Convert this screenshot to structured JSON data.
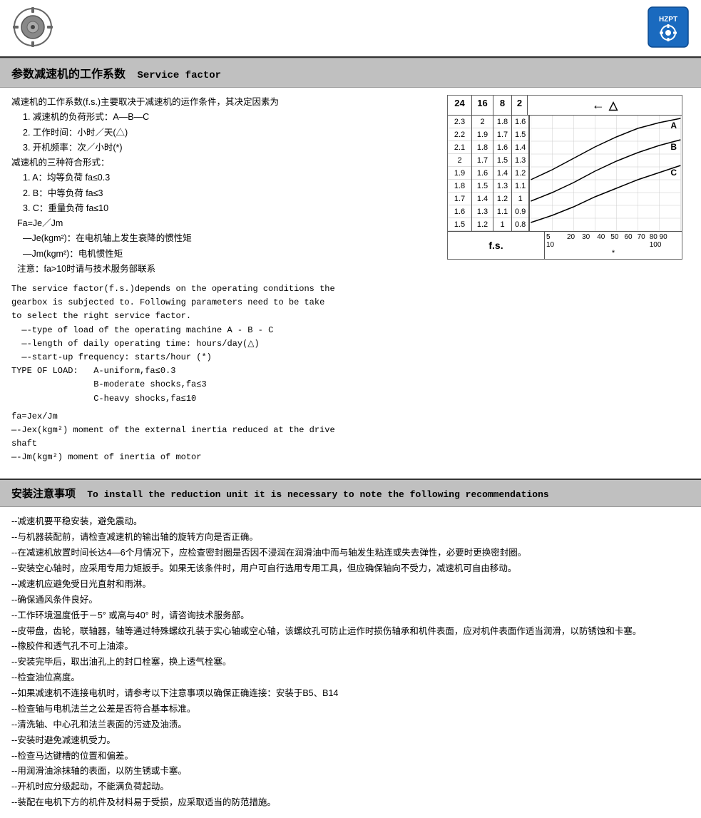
{
  "header": {
    "title_cn": "参数减速机的工作系数",
    "title_en": "Service factor"
  },
  "section1": {
    "intro_cn_lines": [
      "减速机的工作系数(f.s.)主要取决于减速机的运作条件，其决定因素为",
      "    1.  减速机的负荷形式：A—B—C",
      "    2.  工作时间：小时／天(△)",
      "    3.  开机频率：次／小时(*)",
      "减速机的三种符合形式：",
      "    1.  A：均等负荷 fa≤0.3",
      "    2.  B：中等负荷 fa≤3",
      "    3.  C：重量负荷 fa≤10",
      "  Fa=Je／Jm",
      "    —Je(kgm²)：在电机轴上发生衰降的惯性矩",
      "    —Jm(kgm²)：电机惯性矩",
      "  注意：fa>10时请与技术服务部联系"
    ],
    "intro_en_lines": [
      "The service factor(f.s.)depends on the operating conditions the",
      "gearbox is subjected to. Following parameters need to be take",
      "to select the right service factor.",
      "  —-type of load of the operating machine A - B - C",
      "  —-length of daily operating time: hours/day(△)",
      "  —-start-up frequency: starts/hour (*)",
      "TYPE OF LOAD:   A-uniform,fa≤0.3",
      "                B-moderate shocks,fa≤3",
      "                C-heavy shocks,fa≤10",
      "",
      "fa=Jex/Jm",
      "—-Jex(kgm²) moment of the external inertia reduced at the drive",
      "shaft",
      "—-Jm(kgm²) moment of inertia of motor"
    ]
  },
  "chart": {
    "col_headers": [
      "24",
      "16",
      "8",
      "2"
    ],
    "arrow_label": "△",
    "rows": [
      [
        "2.3",
        "2",
        "1.8",
        "1.6"
      ],
      [
        "2.2",
        "1.9",
        "1.7",
        "1.5"
      ],
      [
        "2.1",
        "1.8",
        "1.6",
        "1.4"
      ],
      [
        "2",
        "1.7",
        "1.5",
        "1.3"
      ],
      [
        "1.9",
        "1.6",
        "1.4",
        "1.2"
      ],
      [
        "1.8",
        "1.5",
        "1.3",
        "1.1"
      ],
      [
        "1.7",
        "1.4",
        "1.2",
        "1"
      ],
      [
        "1.6",
        "1.3",
        "1.1",
        "0.9"
      ],
      [
        "1.5",
        "1.2",
        "1",
        "0.8"
      ]
    ],
    "footer_fs": "f.s.",
    "scale_values": [
      "5 10",
      "20",
      "30",
      "40",
      "50",
      "60",
      "70",
      "80 90 100"
    ],
    "footer_star": "*",
    "curve_labels": [
      "A",
      "B",
      "C"
    ]
  },
  "section2": {
    "title_cn": "安装注意事项",
    "title_en": "To install the reduction unit it is necessary to note the following recommendations"
  },
  "install_notes": [
    "--减速机要平稳安装，避免震动。",
    "--与机器装配前，请检查减速机的输出轴的旋转方向是否正确。",
    "--在减速机放置时间长达4—6个月情况下，应检查密封圈是否因不浸润在润滑油中而与轴发生粘连或失去弹性，必要时更换密封圈。",
    "--安装空心轴时，应采用专用力矩扳手。如果无该条件时，用户可自行选用专用工具，但应确保轴向不受力，减速机可自由移动。",
    "--减速机应避免受日光直射和雨淋。",
    "--确保通风条件良好。",
    "--工作环境温度低于－5° 或高与40° 时，请咨询技术服务部。",
    "--皮带盘，齿轮，联轴器，轴等通过特殊螺纹孔装于实心轴或空心轴，该螺纹孔可防止运作时损伤轴承和机件表面，应对机件表面作适当润滑，以防锈蚀和卡塞。",
    "--橡胶件和透气孔不可上油漆。",
    "--安装完毕后，取出油孔上的封口栓塞，换上透气栓塞。",
    "--检查油位高度。",
    "--如果减速机不连接电机时，请参考以下注意事项以确保正确连接：安装于B5、B14",
    "--检查轴与电机法兰之公差是否符合基本标准。",
    "--清洗轴、中心孔和法兰表面的污迹及油渍。",
    "--安装时避免减速机受力。",
    "--检查马达键槽的位置和偏差。",
    "--用润滑油涂抹轴的表面，以防生锈或卡塞。",
    "--开机时应分级起动，不能满负荷起动。",
    "--装配在电机下方的机件及材料易于受损，应采取适当的防范措施。"
  ]
}
